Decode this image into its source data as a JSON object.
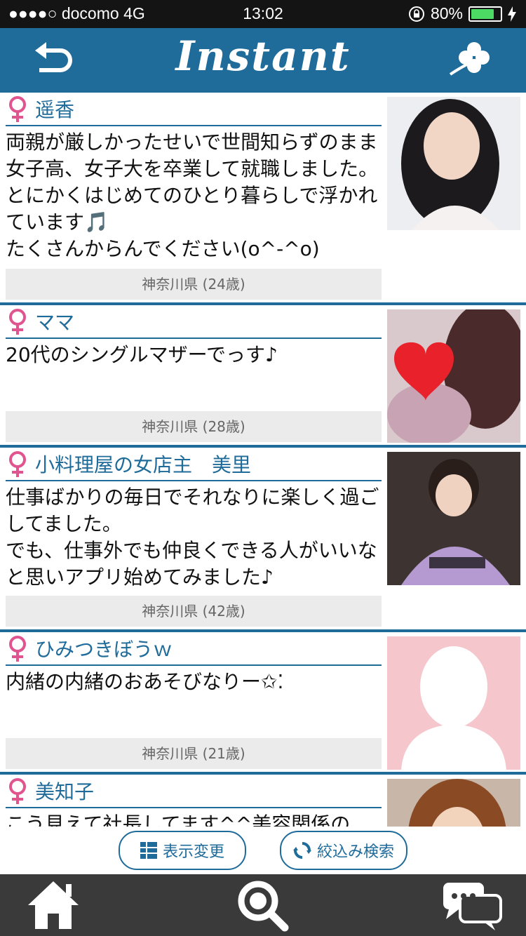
{
  "status": {
    "carrier": "●●●●○ docomo  4G",
    "time": "13:02",
    "battery": "80%"
  },
  "header": {
    "title": "Instant"
  },
  "profiles": [
    {
      "name": "遥香",
      "message": "両親が厳しかったせいで世間知らずのまま女子高、女子大を卒業して就職しました。とにかくはじめてのひとり暮らしで浮かれています🎵\nたくさんからんでください(o^-^o)",
      "location": "神奈川県 (24歳)"
    },
    {
      "name": "ママ",
      "message": "20代のシングルマザーでっす♪",
      "location": "神奈川県 (28歳)"
    },
    {
      "name": "小料理屋の女店主　美里",
      "message": "仕事ばかりの毎日でそれなりに楽しく過ごしてました。\nでも、仕事外でも仲良くできる人がいいなと思いアプリ始めてみました♪",
      "location": "神奈川県 (42歳)"
    },
    {
      "name": "ひみつきぼうｗ",
      "message": "内緒の内緒のおあそびなりー✩⁚",
      "location": "神奈川県 (21歳)"
    },
    {
      "name": "美知子",
      "message": "こう見えて社長してます^^美容関係の",
      "location": ""
    }
  ],
  "actions": {
    "display_change": "表示変更",
    "filter_search": "絞込み検索"
  },
  "colors": {
    "brand": "#1f6b9a",
    "tabbar": "#3a3a3a",
    "female": "#e0548f"
  }
}
